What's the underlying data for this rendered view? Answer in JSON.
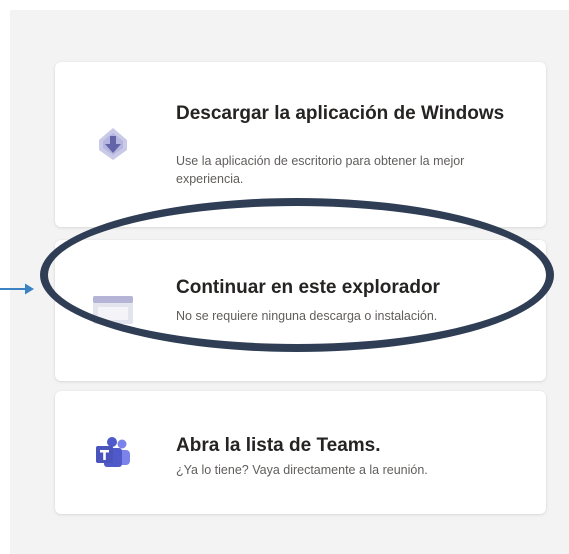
{
  "options": [
    {
      "icon": "download-cloud-icon",
      "title": "Descargar la aplicación de Windows",
      "description": "Use la aplicación de escritorio para obtener la mejor experiencia."
    },
    {
      "icon": "browser-window-icon",
      "title": "Continuar en este explorador",
      "description": "No se requiere ninguna descarga o instalación."
    },
    {
      "icon": "teams-logo-icon",
      "title": "Abra la lista de Teams.",
      "description": "¿Ya lo tiene? Vaya directamente a la reunión."
    }
  ],
  "colors": {
    "accent": "#6264a7",
    "highlight_ellipse": "#2f3e55",
    "pointer_arrow": "#3b82c4"
  }
}
